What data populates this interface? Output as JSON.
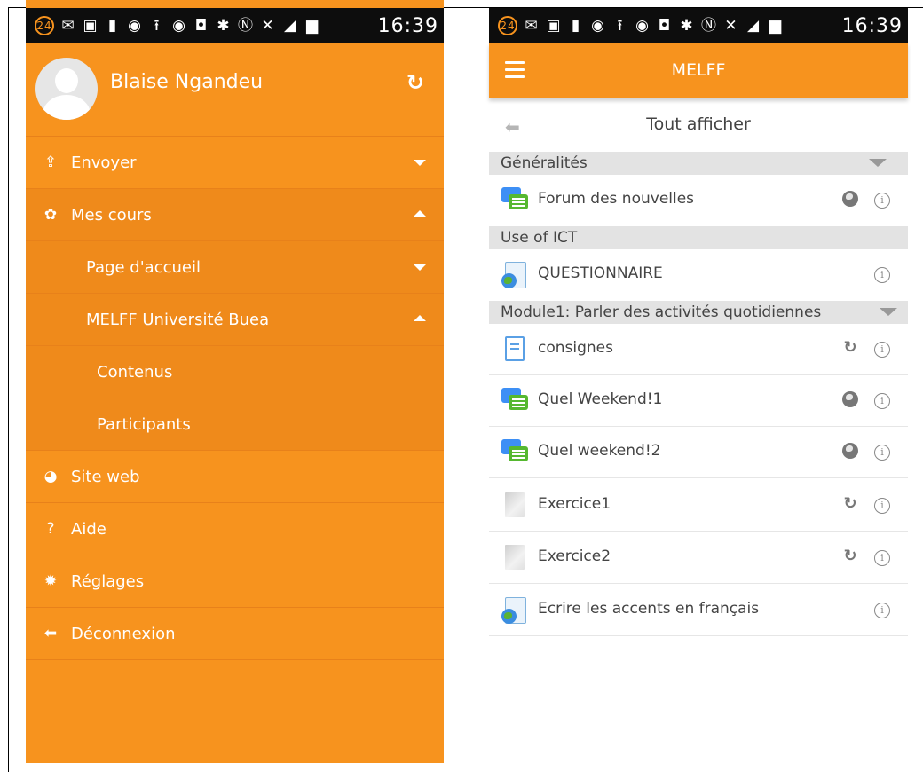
{
  "status_bar": {
    "notification_count": "24",
    "time": "16:39"
  },
  "drawer": {
    "user_name": "Blaise Ngandeu",
    "items": [
      {
        "label": "Envoyer"
      },
      {
        "label": "Mes cours"
      },
      {
        "label": "Page d'accueil"
      },
      {
        "label": "MELFF Université Buea"
      },
      {
        "label": "Contenus"
      },
      {
        "label": "Participants"
      },
      {
        "label": "Site web"
      },
      {
        "label": "Aide"
      },
      {
        "label": "Réglages"
      },
      {
        "label": "Déconnexion"
      }
    ]
  },
  "course": {
    "app_title": "MELFF",
    "nav_title": "Tout afficher",
    "sections": [
      {
        "name": "Généralités",
        "activities": [
          {
            "label": "Forum des nouvelles"
          }
        ]
      },
      {
        "name": "Use of ICT",
        "activities": [
          {
            "label": "QUESTIONNAIRE"
          }
        ]
      },
      {
        "name": "Module1: Parler des activités quotidiennes",
        "activities": [
          {
            "label": "consignes"
          },
          {
            "label": "Quel Weekend!1"
          },
          {
            "label": "Quel weekend!2"
          },
          {
            "label": "Exercice1"
          },
          {
            "label": "Exercice2"
          },
          {
            "label": "Ecrire les accents en français"
          }
        ]
      }
    ]
  },
  "colors": {
    "accent": "#f7931e",
    "status_bar": "#0d0d0d"
  }
}
